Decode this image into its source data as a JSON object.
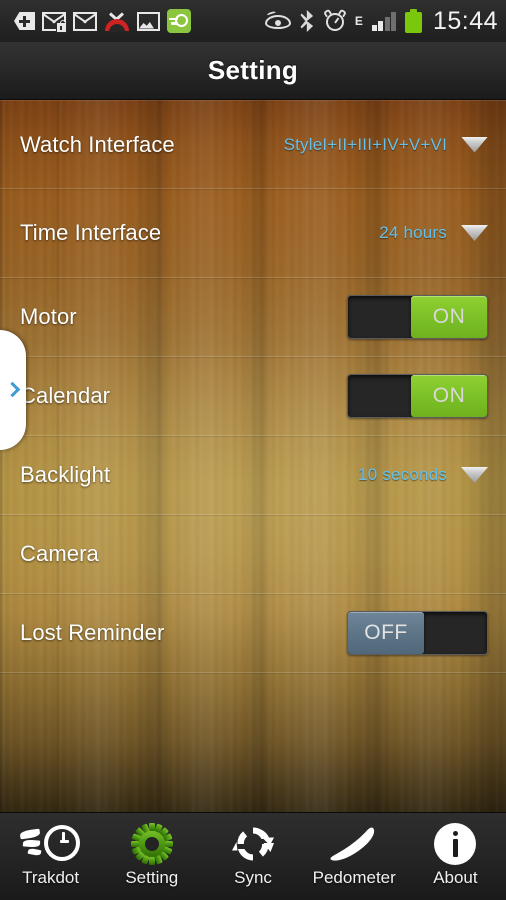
{
  "statusbar": {
    "time": "15:44",
    "network_type": "E",
    "icons_left": [
      {
        "name": "back-tag-icon",
        "label": "back"
      },
      {
        "name": "secure-mail-icon",
        "label": "secure mail"
      },
      {
        "name": "mail-icon",
        "label": "mail"
      },
      {
        "name": "missed-call-icon",
        "label": "missed call"
      },
      {
        "name": "picture-icon",
        "label": "screenshot"
      },
      {
        "name": "trakdot-app-icon",
        "label": "trakdot"
      }
    ],
    "icons_right": [
      {
        "name": "eye-icon",
        "label": "smart stay"
      },
      {
        "name": "bluetooth-icon",
        "label": "bluetooth"
      },
      {
        "name": "alarm-icon",
        "label": "alarm"
      },
      {
        "name": "signal-icon",
        "label": "signal"
      },
      {
        "name": "battery-icon",
        "label": "battery"
      }
    ]
  },
  "titlebar": {
    "title": "Setting"
  },
  "settings": {
    "rows": [
      {
        "label": "Watch Interface",
        "type": "dropdown",
        "value": "StyleI+II+III+IV+V+VI"
      },
      {
        "label": "Time Interface",
        "type": "dropdown",
        "value": "24 hours"
      },
      {
        "label": "Motor",
        "type": "toggle",
        "value": "ON"
      },
      {
        "label": "Calendar",
        "type": "toggle",
        "value": "ON"
      },
      {
        "label": "Backlight",
        "type": "dropdown",
        "value": "10 seconds"
      },
      {
        "label": "Camera",
        "type": "none",
        "value": ""
      },
      {
        "label": "Lost Reminder",
        "type": "toggle",
        "value": "OFF"
      }
    ]
  },
  "drawer": {
    "icon": "chevron-right-icon"
  },
  "bottomnav": {
    "items": [
      {
        "label": "Trakdot",
        "icon": "flaming-clock-icon",
        "active": false
      },
      {
        "label": "Setting",
        "icon": "gear-icon",
        "active": true
      },
      {
        "label": "Sync",
        "icon": "sync-icon",
        "active": false
      },
      {
        "label": "Pedometer",
        "icon": "shoe-icon",
        "active": false
      },
      {
        "label": "About",
        "icon": "info-icon",
        "active": false
      }
    ]
  },
  "colors": {
    "accent_value": "#63c0ea",
    "toggle_on": "#7cc127",
    "toggle_off": "#5c7486",
    "gear_green": "#4d9b12",
    "battery_green": "#7ac70c",
    "drawer_chevron": "#3f9bd4"
  }
}
